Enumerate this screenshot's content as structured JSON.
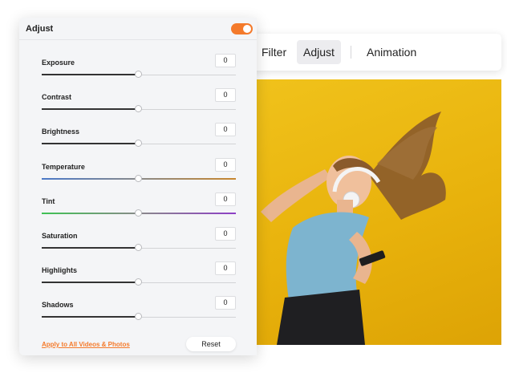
{
  "toolbar": {
    "tabs": [
      {
        "label": "Filter",
        "active": false
      },
      {
        "label": "Adjust",
        "active": true
      },
      {
        "label": "Animation",
        "active": false
      }
    ]
  },
  "panel": {
    "title": "Adjust",
    "toggle_on": true,
    "accent_color": "#f47a2b",
    "sliders": [
      {
        "label": "Exposure",
        "value": "0",
        "position_pct": 50,
        "track": "plain"
      },
      {
        "label": "Contrast",
        "value": "0",
        "position_pct": 50,
        "track": "plain"
      },
      {
        "label": "Brightness",
        "value": "0",
        "position_pct": 50,
        "track": "plain"
      },
      {
        "label": "Temperature",
        "value": "0",
        "position_pct": 50,
        "track": "blue-orange"
      },
      {
        "label": "Tint",
        "value": "0",
        "position_pct": 50,
        "track": "green-purple"
      },
      {
        "label": "Saturation",
        "value": "0",
        "position_pct": 50,
        "track": "plain"
      },
      {
        "label": "Highlights",
        "value": "0",
        "position_pct": 50,
        "track": "plain"
      },
      {
        "label": "Shadows",
        "value": "0",
        "position_pct": 50,
        "track": "plain"
      }
    ],
    "apply_all_label": "Apply to All Videos & Photos",
    "reset_label": "Reset"
  },
  "preview": {
    "icon": "photo-preview",
    "background_color": "#e8b20c"
  }
}
